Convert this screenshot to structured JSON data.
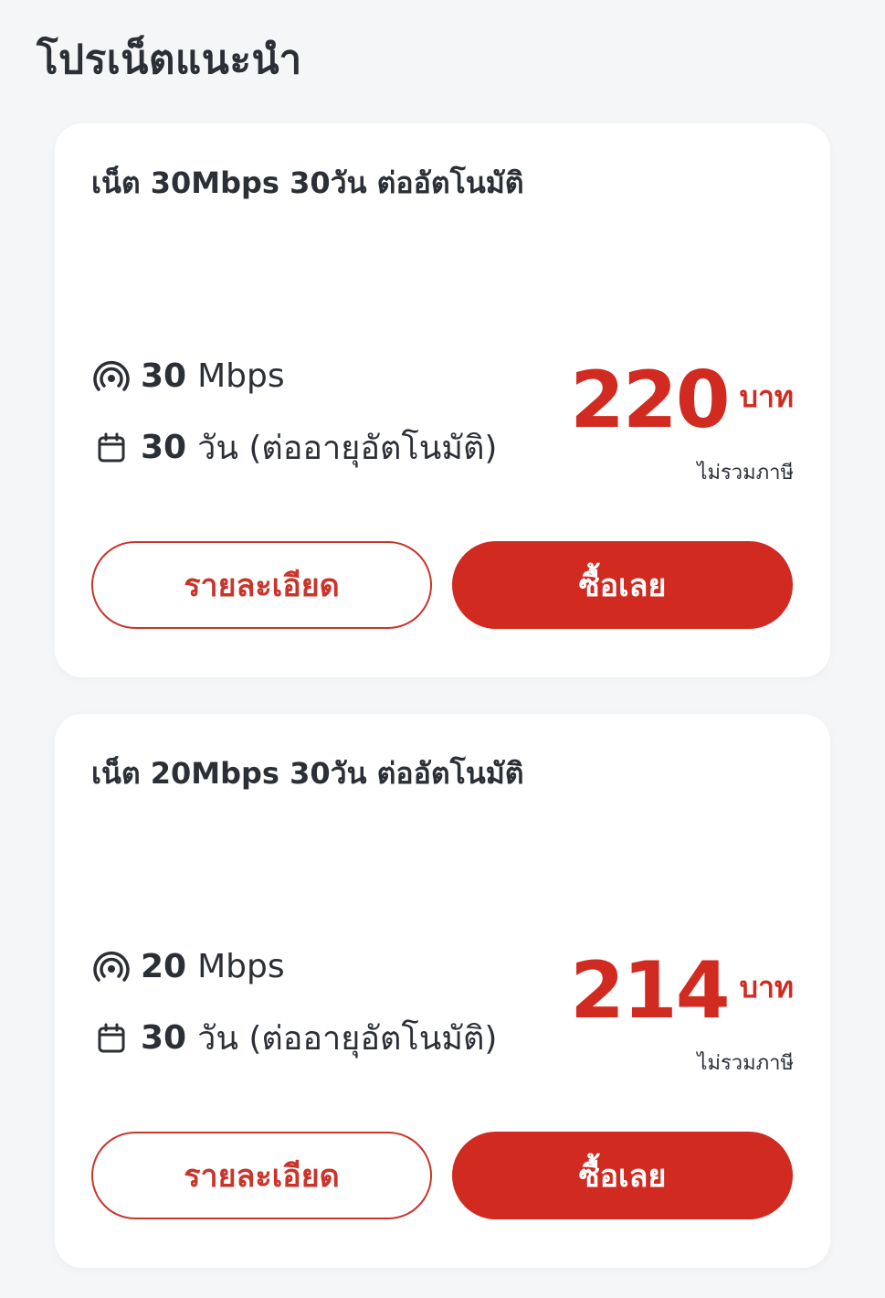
{
  "page": {
    "title": "โปรเน็ตแนะนำ"
  },
  "colors": {
    "accent": "#d12a20",
    "text": "#2b2f36",
    "background": "#f5f6f8",
    "card": "#ffffff"
  },
  "icons": {
    "speed": "wifi-signal-icon",
    "duration": "calendar-icon"
  },
  "packages": [
    {
      "name": "เน็ต 30Mbps 30วัน ต่ออัตโนมัติ",
      "speed_value": "30",
      "speed_unit": "Mbps",
      "days_value": "30",
      "days_text": "วัน (ต่ออายุอัตโนมัติ)",
      "price": "220",
      "currency": "บาท",
      "price_note": "ไม่รวมภาษี",
      "details_label": "รายละเอียด",
      "buy_label": "ซื้อเลย"
    },
    {
      "name": "เน็ต 20Mbps 30วัน ต่ออัตโนมัติ",
      "speed_value": "20",
      "speed_unit": "Mbps",
      "days_value": "30",
      "days_text": "วัน (ต่ออายุอัตโนมัติ)",
      "price": "214",
      "currency": "บาท",
      "price_note": "ไม่รวมภาษี",
      "details_label": "รายละเอียด",
      "buy_label": "ซื้อเลย"
    }
  ]
}
